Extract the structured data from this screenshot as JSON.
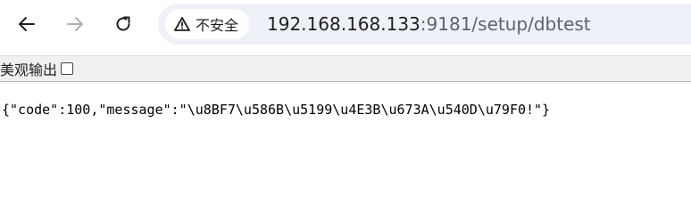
{
  "browser": {
    "security_label": "不安全",
    "url_host": "192.168.168.133",
    "url_rest": ":9181/setup/dbtest"
  },
  "page": {
    "pretty_print_label": "美观输出",
    "json_text": "{\"code\":100,\"message\":\"\\u8BF7\\u586B\\u5199\\u4E3B\\u673A\\u540D\\u79F0!\"}"
  },
  "icons": {
    "back": "arrow-left-icon",
    "forward": "arrow-right-icon",
    "reload": "reload-icon",
    "security": "warning-triangle-icon"
  },
  "colors": {
    "omnibox_bg": "#eef2f8",
    "pretty_bar_bg": "#f0f0f0",
    "forward_disabled": "#b0b0b0"
  }
}
